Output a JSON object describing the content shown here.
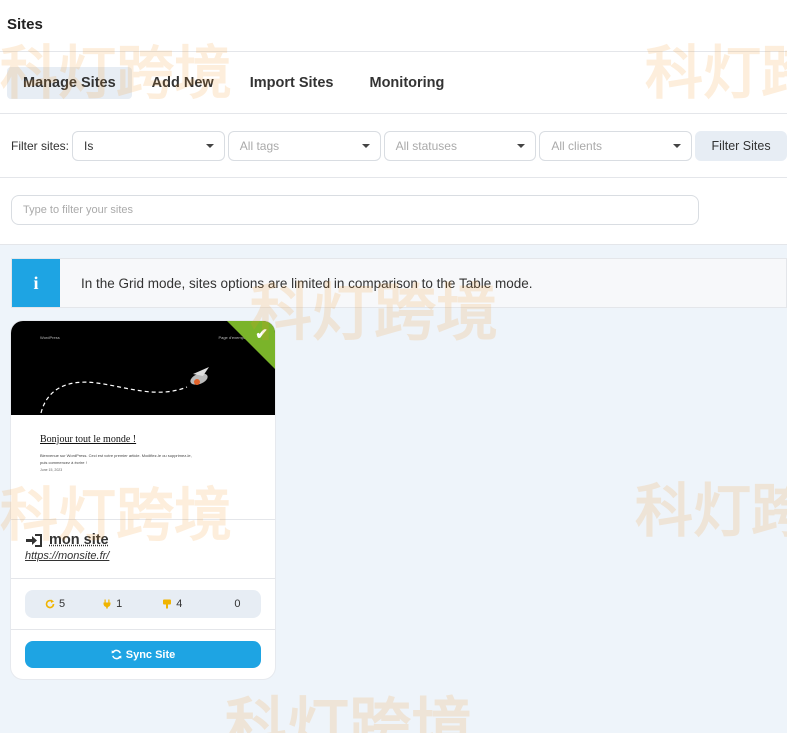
{
  "header": {
    "title": "Sites"
  },
  "tabs": [
    {
      "label": "Manage Sites",
      "active": true
    },
    {
      "label": "Add New",
      "active": false
    },
    {
      "label": "Import Sites",
      "active": false
    },
    {
      "label": "Monitoring",
      "active": false
    }
  ],
  "filters": {
    "label": "Filter sites:",
    "selects": [
      {
        "value": "Is"
      },
      {
        "placeholder": "All tags"
      },
      {
        "placeholder": "All statuses"
      },
      {
        "placeholder": "All clients"
      }
    ],
    "button_label": "Filter Sites"
  },
  "search": {
    "placeholder": "Type to filter your sites"
  },
  "notice": {
    "text": "In the Grid mode, sites options are limited in comparison to the Table mode."
  },
  "site_card": {
    "preview": {
      "site_name": "WordPress",
      "nav": "Page d'exemple",
      "post_title": "Bonjour tout le monde !",
      "excerpt": "Bienvenue sur WordPress. Ceci est votre premier article. Modifiez-le ou supprimez-le, puis commencez à écrire !",
      "date": "June 15, 2023"
    },
    "name": "mon site",
    "url": "https://monsite.fr/",
    "stats": {
      "updates": "5",
      "plugins": "1",
      "themes": "4",
      "other": "0"
    },
    "sync_label": "Sync Site"
  },
  "watermark": {
    "text": "科灯跨境"
  },
  "colors": {
    "accent": "#1ea4e3",
    "success": "#7ab42a",
    "warning": "#f0b400"
  }
}
